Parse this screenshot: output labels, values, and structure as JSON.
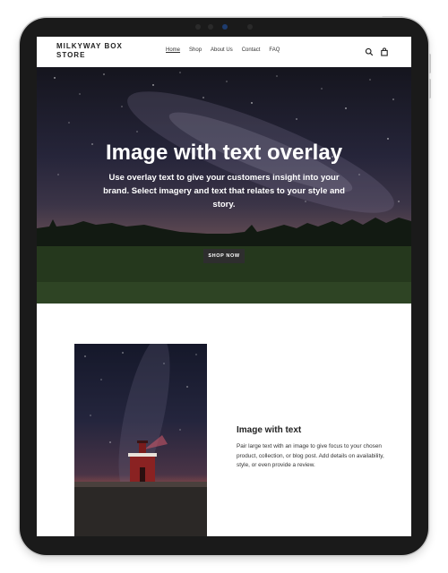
{
  "store": {
    "name": "MILKYWAY BOX STORE"
  },
  "nav": {
    "items": [
      "Home",
      "Shop",
      "About Us",
      "Contact",
      "FAQ"
    ]
  },
  "header_icons": [
    "search-icon",
    "bag-icon"
  ],
  "hero": {
    "title": "Image with text overlay",
    "text": "Use overlay text to give your customers insight into your brand. Select imagery and text that relates to your style and story.",
    "button_label": "SHOP NOW"
  },
  "feature": {
    "title": "Image with text",
    "text": "Pair large text with an image to give focus to your chosen product, collection, or blog post. Add details on availability, style, or even provide a review."
  },
  "colors": {
    "device": "#1a1a1a",
    "button": "#2e2e2e",
    "text": "#222222"
  }
}
